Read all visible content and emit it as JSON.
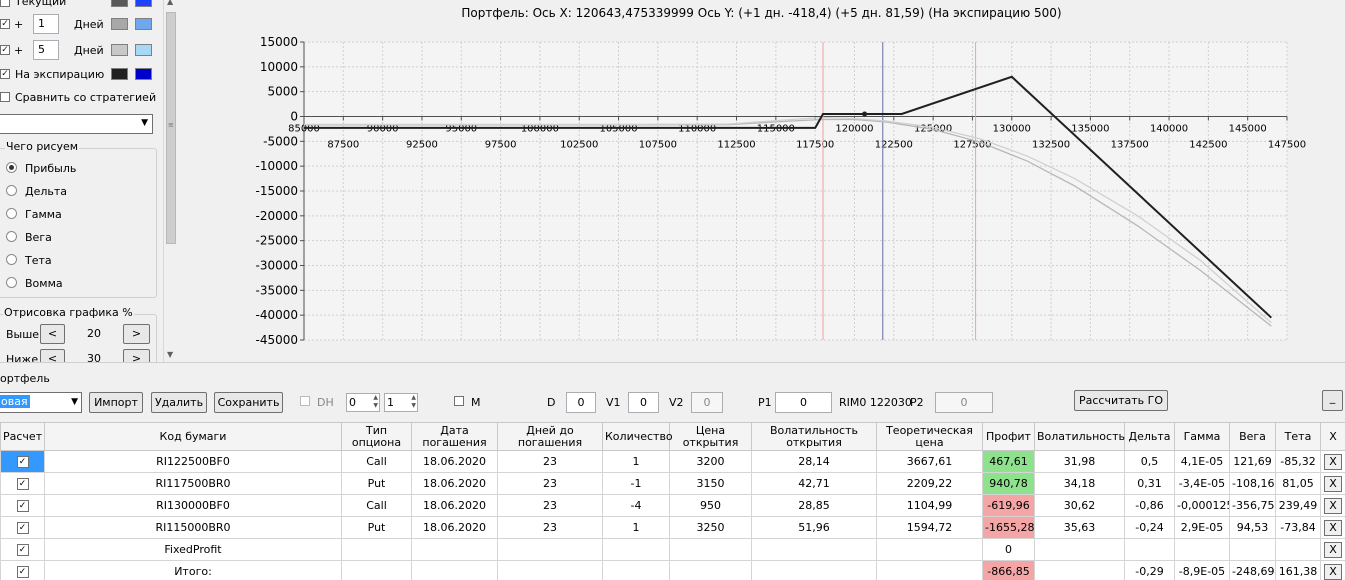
{
  "left_panel": {
    "rows": [
      {
        "label": "Текущий",
        "checked": false,
        "color1": "#5a5a5a",
        "color2": "#1e40ff"
      },
      {
        "prefix": "+",
        "days": "1",
        "unit": "Дней",
        "checked": true,
        "color1": "#a8a8a8",
        "color2": "#6fa8ef"
      },
      {
        "prefix": "+",
        "days": "5",
        "unit": "Дней",
        "checked": true,
        "color1": "#c8c8c8",
        "color2": "#a8d8f8"
      },
      {
        "label": "На экспирацию",
        "checked": true,
        "color1": "#202020",
        "color2": "#0000cc"
      }
    ],
    "compare_label": "Сравнить со стратегией",
    "group_title": "Чего рисуем",
    "radios": [
      "Прибыль",
      "Дельта",
      "Гамма",
      "Вега",
      "Тета",
      "Вомма"
    ],
    "radio_selected": 0,
    "draw_title": "Отрисовка графика %",
    "above_label": "Выше",
    "above_value": "20",
    "below_label": "Ниже",
    "below_value": "30",
    "prev": "<",
    "next": ">"
  },
  "chart": {
    "title": "Портфель: Ось X: 120643,475339999 Ось Y:  (+1 дн. -418,4)  (+5 дн. 81,59)  (На экспирацию 500)"
  },
  "chart_data": {
    "type": "line",
    "title": "Портфель: Ось X: 120643,475339999 Ось Y:  (+1 дн. -418,4)  (+5 дн. 81,59)  (На экспирацию 500)",
    "xlim": [
      85000,
      147500
    ],
    "ylim": [
      -45000,
      15000
    ],
    "x_ticks_upper": [
      85000,
      90000,
      95000,
      100000,
      105000,
      110000,
      115000,
      120000,
      125000,
      130000,
      135000,
      140000,
      145000
    ],
    "x_ticks_lower": [
      87500,
      92500,
      97500,
      102500,
      107500,
      112500,
      117500,
      122500,
      127500,
      132500,
      137500,
      142500,
      147500
    ],
    "y_ticks": [
      15000,
      10000,
      5000,
      0,
      -5000,
      -10000,
      -15000,
      -20000,
      -25000,
      -30000,
      -35000,
      -40000,
      -45000
    ],
    "grid": true,
    "vlines_red": [
      118000,
      127700
    ],
    "vline_blue": 121800,
    "marker": {
      "x": 120643,
      "y": 500
    },
    "series": [
      {
        "color": "#202020",
        "x": [
          85000,
          115000,
          117500,
          118000,
          123000,
          130000,
          146500
        ],
        "y": [
          -2300,
          -2300,
          -2300,
          500,
          500,
          8000,
          -40500
        ]
      },
      {
        "color": "#d0d0d0",
        "x": [
          85000,
          105000,
          112000,
          116000,
          118000,
          120000,
          122000,
          125000,
          128000,
          131000,
          134000,
          138000,
          142000,
          146500
        ],
        "y": [
          -1600,
          -1600,
          -1500,
          -600,
          -200,
          -400,
          -900,
          -2200,
          -4500,
          -8000,
          -12500,
          -20000,
          -29000,
          -41500
        ]
      },
      {
        "color": "#b8b8b8",
        "x": [
          85000,
          105000,
          112000,
          116000,
          118000,
          120000,
          122000,
          125000,
          128000,
          131000,
          134000,
          138000,
          142000,
          146500
        ],
        "y": [
          -1700,
          -1700,
          -1650,
          -900,
          -600,
          -600,
          -1100,
          -2600,
          -5200,
          -9000,
          -14000,
          -22000,
          -31000,
          -42200
        ]
      }
    ]
  },
  "portfolio": {
    "title": "ортфель",
    "select_value": "овая",
    "import_btn": "Импорт",
    "delete_btn": "Удалить",
    "save_btn": "Сохранить",
    "dh_label": "DH",
    "spin1": "0",
    "spin2": "1",
    "m_label": "M",
    "d_label": "D",
    "d_value": "0",
    "v1_label": "V1",
    "v1_value": "0",
    "v2_label": "V2",
    "v2_value": "0",
    "p1_label": "P1",
    "p1_value": "0",
    "rim_text": "RIM0 122030",
    "p2_label": "P2",
    "p2_value": "0",
    "go_btn": "Рассчитать ГО",
    "min_btn": "_"
  },
  "table": {
    "headers": [
      "Расчет",
      "Код бумаги",
      "Тип опциона",
      "Дата погашения",
      "Дней до погашения",
      "Количество",
      "Цена открытия",
      "Волатильность открытия",
      "Теоретическая цена",
      "Профит",
      "Волатильность",
      "Дельта",
      "Гамма",
      "Вега",
      "Тета",
      "X"
    ],
    "rows": [
      {
        "code": "RI122500BF0",
        "type": "Call",
        "date": "18.06.2020",
        "days": "23",
        "qty": "1",
        "price": "3200",
        "vol_open": "28,14",
        "theo": "3667,61",
        "profit": "467,61",
        "pstate": "green",
        "vol": "31,98",
        "delta": "0,5",
        "gamma": "4,1E-05",
        "vega": "121,69",
        "theta": "-85,32",
        "x": "X"
      },
      {
        "code": "RI117500BR0",
        "type": "Put",
        "date": "18.06.2020",
        "days": "23",
        "qty": "-1",
        "price": "3150",
        "vol_open": "42,71",
        "theo": "2209,22",
        "profit": "940,78",
        "pstate": "green",
        "vol": "34,18",
        "delta": "0,31",
        "gamma": "-3,4E-05",
        "vega": "-108,16",
        "theta": "81,05",
        "x": "X"
      },
      {
        "code": "RI130000BF0",
        "type": "Call",
        "date": "18.06.2020",
        "days": "23",
        "qty": "-4",
        "price": "950",
        "vol_open": "28,85",
        "theo": "1104,99",
        "profit": "-619,96",
        "pstate": "red",
        "vol": "30,62",
        "delta": "-0,86",
        "gamma": "-0,000125",
        "vega": "-356,75",
        "theta": "239,49",
        "x": "X"
      },
      {
        "code": "RI115000BR0",
        "type": "Put",
        "date": "18.06.2020",
        "days": "23",
        "qty": "1",
        "price": "3250",
        "vol_open": "51,96",
        "theo": "1594,72",
        "profit": "-1655,28",
        "pstate": "red",
        "vol": "35,63",
        "delta": "-0,24",
        "gamma": "2,9E-05",
        "vega": "94,53",
        "theta": "-73,84",
        "x": "X"
      },
      {
        "code": "FixedProfit",
        "type": "",
        "date": "",
        "days": "",
        "qty": "",
        "price": "",
        "vol_open": "",
        "theo": "",
        "profit": "0",
        "pstate": "",
        "vol": "",
        "delta": "",
        "gamma": "",
        "vega": "",
        "theta": "",
        "x": "X"
      },
      {
        "code": "Итого:",
        "type": "",
        "date": "",
        "days": "",
        "qty": "",
        "price": "",
        "vol_open": "",
        "theo": "",
        "profit": "-866,85",
        "pstate": "red",
        "vol": "",
        "delta": "-0,29",
        "gamma": "-8,9E-05",
        "vega": "-248,69",
        "theta": "161,38",
        "x": "X"
      }
    ]
  }
}
